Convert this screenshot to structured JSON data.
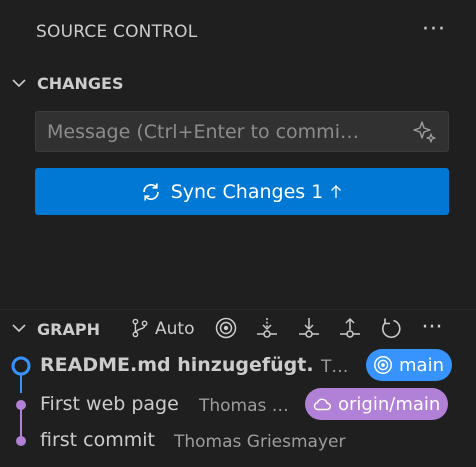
{
  "header": {
    "title": "SOURCE CONTROL",
    "more_icon": "ellipsis-icon"
  },
  "changes": {
    "title": "CHANGES",
    "message_placeholder": "Message (Ctrl+Enter to commi…",
    "sync_label": "Sync Changes 1",
    "sync_icon": "sync-icon",
    "accent": "#0078d4"
  },
  "graph": {
    "title": "GRAPH",
    "auto_label": "Auto",
    "commits": [
      {
        "title": "README.md hinzugefügt.",
        "author": "T…",
        "ref": "main",
        "ref_color": "#3794ff",
        "bold": true
      },
      {
        "title": "First web page",
        "author": "Thomas …",
        "ref": "origin/main",
        "ref_color": "#b180d7",
        "bold": false
      },
      {
        "title": "first commit",
        "author": "Thomas Griesmayer",
        "ref": "",
        "bold": false
      }
    ],
    "line_color": "#3794ff",
    "remote_line_color": "#b180d7"
  }
}
